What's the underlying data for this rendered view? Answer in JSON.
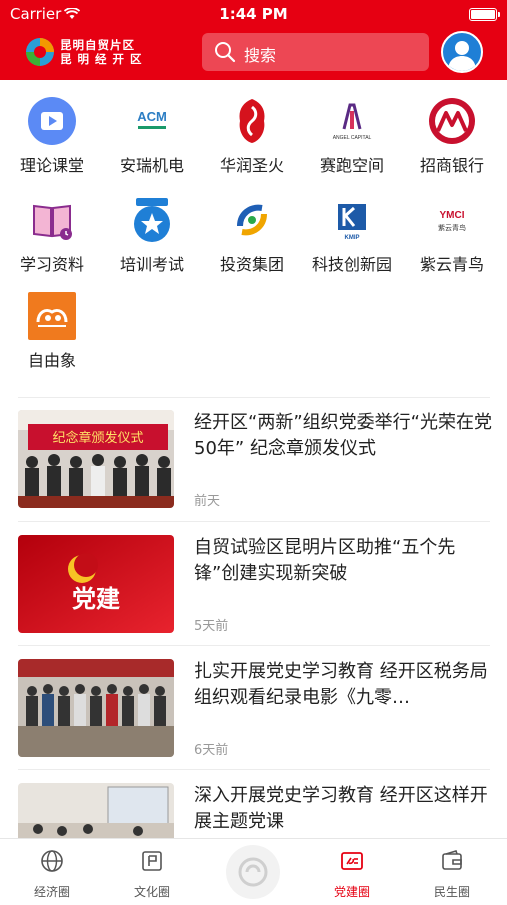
{
  "status_bar": {
    "carrier": "Carrier",
    "time": "1:44 PM"
  },
  "header": {
    "logo_line1": "昆明自贸片区",
    "logo_line2": "昆 明 经 开 区",
    "search_placeholder": "搜索"
  },
  "grid": [
    {
      "label": "理论课堂",
      "icon": "video-play-icon"
    },
    {
      "label": "安瑞机电",
      "icon": "acm-logo"
    },
    {
      "label": "华润圣火",
      "icon": "huarun-logo"
    },
    {
      "label": "赛跑空间",
      "icon": "angel-capital-logo"
    },
    {
      "label": "招商银行",
      "icon": "cmb-logo"
    },
    {
      "label": "学习资料",
      "icon": "book-icon"
    },
    {
      "label": "培训考试",
      "icon": "star-badge-icon"
    },
    {
      "label": "投资集团",
      "icon": "investment-logo"
    },
    {
      "label": "科技创新园",
      "icon": "kmip-logo"
    },
    {
      "label": "紫云青鸟",
      "icon": "ymci-logo"
    },
    {
      "label": "自由象",
      "icon": "elephant-logo"
    }
  ],
  "grid_logo_text": {
    "acm": "ACM",
    "angel": "ANGEL CAPITAL",
    "kmip": "KMIP",
    "ymci": "YMCI",
    "ymci_sub": "紫云青鸟"
  },
  "news": [
    {
      "title": "经开区“两新”组织党委举行“光荣在党50年” 纪念章颁发仪式",
      "time": "前天",
      "thumb_text": "纪念章颁发仪式"
    },
    {
      "title": "自贸试验区昆明片区助推“五个先锋”创建实现新突破",
      "time": "5天前",
      "thumb_text": "党建"
    },
    {
      "title": "扎实开展党史学习教育 经开区税务局组织观看纪录电影《九零…",
      "time": "6天前",
      "thumb_text": ""
    },
    {
      "title": "深入开展党史学习教育  经开区这样开展主题党课",
      "time": "",
      "thumb_text": ""
    }
  ],
  "tabbar": [
    {
      "label": "经济圈",
      "icon": "globe-icon",
      "active": false
    },
    {
      "label": "文化圈",
      "icon": "flag-icon",
      "active": false
    },
    {
      "label": "党建圈",
      "icon": "party-icon",
      "active": true
    },
    {
      "label": "民生圈",
      "icon": "wallet-icon",
      "active": false
    }
  ],
  "colors": {
    "brand_red": "#e60012",
    "text": "#222222",
    "muted": "#999999"
  }
}
